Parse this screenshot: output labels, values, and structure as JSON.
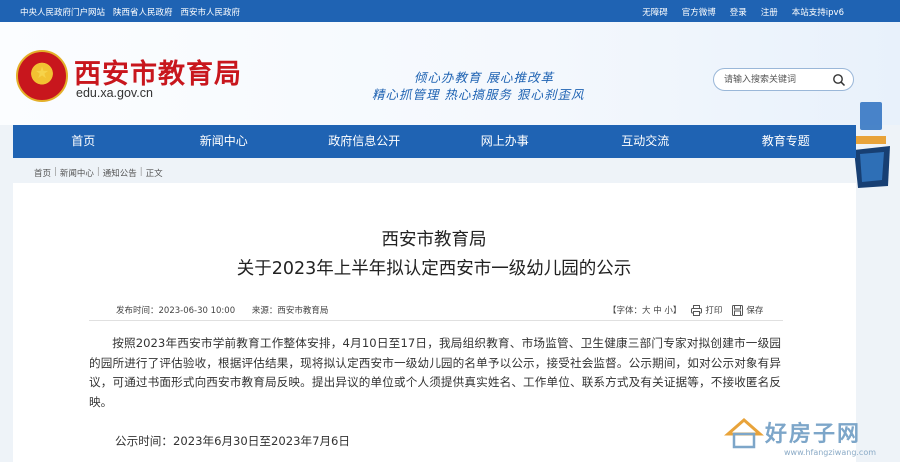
{
  "topbar": {
    "left_links": [
      "中央人民政府门户网站",
      "陕西省人民政府",
      "西安市人民政府"
    ],
    "right_links": [
      "无障碍",
      "官方微博",
      "登录",
      "注册",
      "本站支持ipv6"
    ]
  },
  "header": {
    "title": "西安市教育局",
    "domain": "edu.xa.gov.cn",
    "slogan_line1": "倾心办教育  展心推改革",
    "slogan_line2": "精心抓管理  热心搞服务  狠心刹歪风",
    "search_placeholder": "请输入搜索关键词"
  },
  "nav": {
    "items": [
      "首页",
      "新闻中心",
      "政府信息公开",
      "网上办事",
      "互动交流",
      "教育专题"
    ]
  },
  "breadcrumb": [
    "首页",
    "新闻中心",
    "通知公告",
    "正文"
  ],
  "article": {
    "title_line1": "西安市教育局",
    "title_line2": "关于2023年上半年拟认定西安市一级幼儿园的公示",
    "publish_time": "发布时间：2023-06-30 10:00",
    "source": "来源：西安市教育局",
    "font_size": "【字体：大 中 小】",
    "print_label": "打印",
    "save_label": "保存",
    "body": "按照2023年西安市学前教育工作整体安排，4月10日至17日，我局组织教育、市场监管、卫生健康三部门专家对拟创建市一级园的园所进行了评估验收，根据评估结果，现将拟认定西安市一级幼儿园的名单予以公示，接受社会监督。公示期间，如对公示对象有异议，可通过书面形式向西安市教育局反映。提出异议的单位或个人须提供真实姓名、工作单位、联系方式及有关证据等，不接收匿名反映。",
    "period": "公示时间：2023年6月30日至2023年7月6日"
  },
  "watermark": {
    "text": "好房子网",
    "url": "www.hfangziwang.com"
  },
  "colors": {
    "brand_blue": "#1f63b3",
    "title_red": "#c8161d"
  }
}
